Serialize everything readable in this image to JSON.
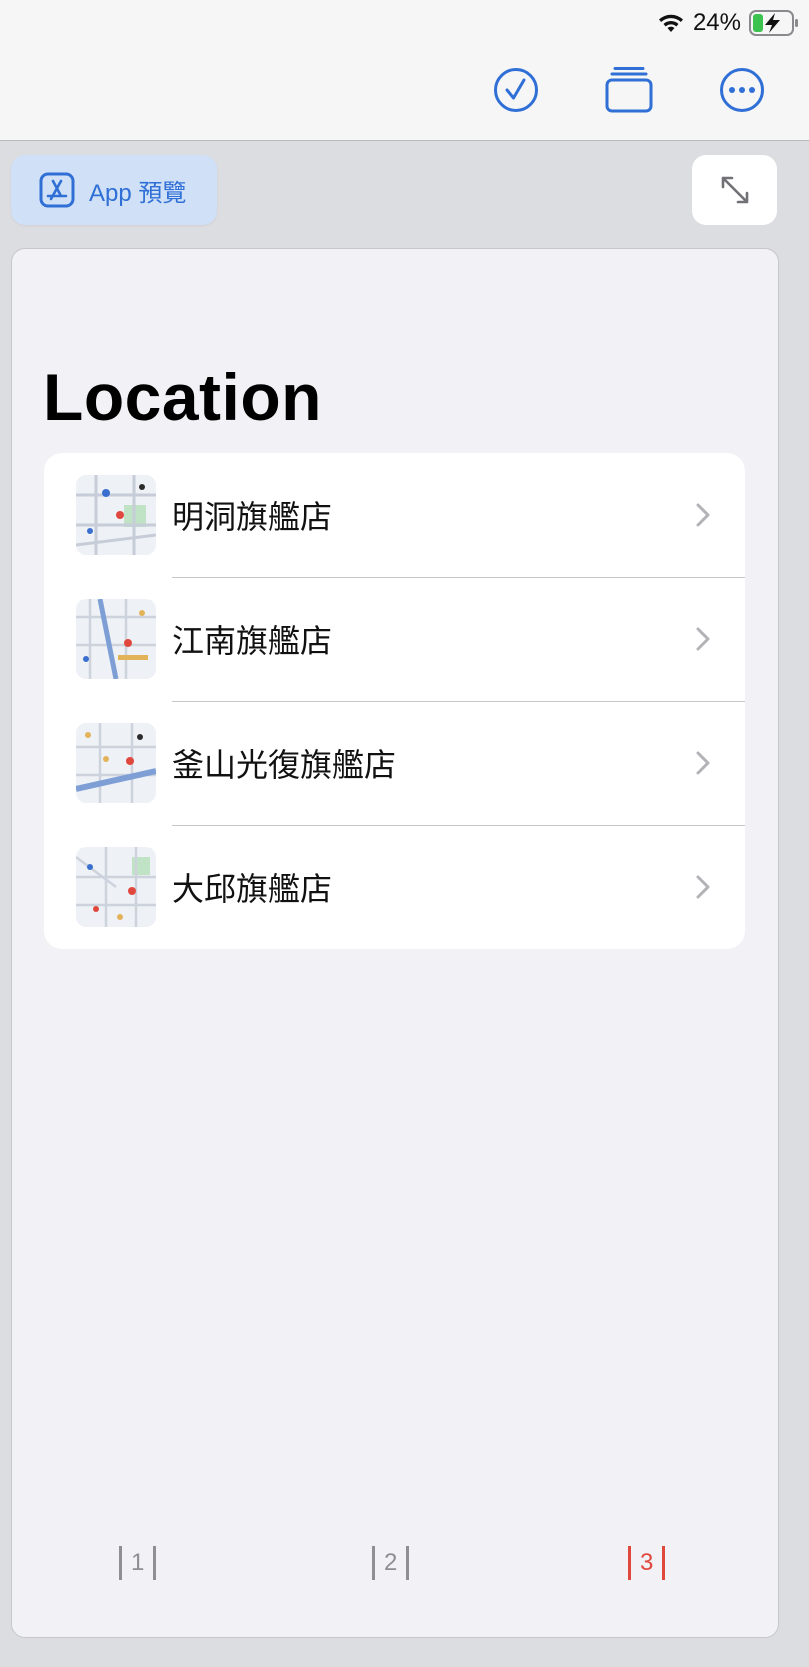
{
  "status_bar": {
    "battery_percent": "24%",
    "battery_level": 0.24,
    "charging": true
  },
  "toolbar": {
    "buttons": [
      {
        "name": "check-circle-icon"
      },
      {
        "name": "windows-icon"
      },
      {
        "name": "more-icon"
      }
    ],
    "accent_color": "#2f6fd6"
  },
  "app_preview": {
    "label": "App 預覽",
    "icon": "app-store-icon"
  },
  "expand": {
    "icon": "expand-arrows-icon"
  },
  "page": {
    "title": "Location",
    "items": [
      {
        "label": "明洞旗艦店",
        "thumb": "map-thumbnail-icon"
      },
      {
        "label": "江南旗艦店",
        "thumb": "map-thumbnail-icon"
      },
      {
        "label": "釜山光復旗艦店",
        "thumb": "map-thumbnail-icon"
      },
      {
        "label": "大邱旗艦店",
        "thumb": "map-thumbnail-icon"
      }
    ]
  },
  "pager": {
    "pages": [
      "1",
      "2",
      "3"
    ],
    "active": "3",
    "active_color": "#e0483e"
  }
}
